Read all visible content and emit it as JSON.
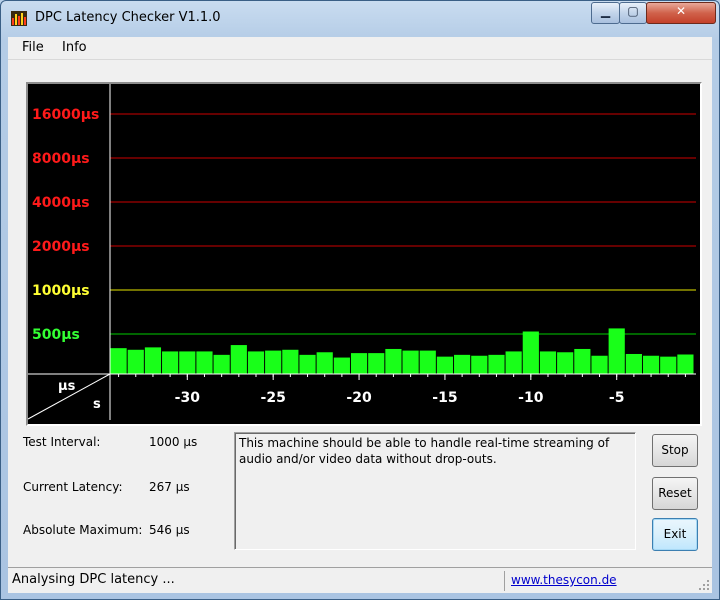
{
  "window": {
    "title": "DPC Latency Checker V1.1.0",
    "title_buttons": {
      "minimize": "▁",
      "maximize": "▢",
      "close": "✕"
    }
  },
  "menu": {
    "items": [
      "File",
      "Info"
    ]
  },
  "chart_data": {
    "type": "bar",
    "y_scale": "log2",
    "y_tick_labels": [
      "16000µs",
      "8000µs",
      "4000µs",
      "2000µs",
      "1000µs",
      "500µs"
    ],
    "y_ticks": [
      16000,
      8000,
      4000,
      2000,
      1000,
      500
    ],
    "y_tick_colors": [
      "#ff1a1a",
      "#ff1a1a",
      "#ff1a1a",
      "#ff1a1a",
      "#ffff33",
      "#33ff33"
    ],
    "gridline_colors": [
      "#cc0000",
      "#cc0000",
      "#cc0000",
      "#cc0000",
      "#e6e600",
      "#00cc00"
    ],
    "x_tick_labels": [
      "-30",
      "-25",
      "-20",
      "-15",
      "-10",
      "-5"
    ],
    "x_ticks": [
      -30,
      -25,
      -20,
      -15,
      -10,
      -5
    ],
    "x_range": [
      -34.5,
      -0.5
    ],
    "y_range": [
      250,
      20000
    ],
    "corner_labels": {
      "y_unit": "µs",
      "x_unit": "s"
    },
    "bar_color": "#19ff19",
    "x": [
      -34,
      -33,
      -32,
      -31,
      -30,
      -29,
      -28,
      -27,
      -26,
      -25,
      -24,
      -23,
      -22,
      -21,
      -20,
      -19,
      -18,
      -17,
      -16,
      -15,
      -14,
      -13,
      -12,
      -11,
      -10,
      -9,
      -8,
      -7,
      -6,
      -5,
      -4,
      -3,
      -2,
      -1
    ],
    "values": [
      400,
      390,
      405,
      380,
      380,
      380,
      360,
      420,
      380,
      385,
      390,
      360,
      375,
      345,
      370,
      370,
      395,
      385,
      385,
      350,
      360,
      355,
      360,
      380,
      520,
      380,
      375,
      395,
      355,
      546,
      365,
      355,
      350,
      362
    ]
  },
  "info": {
    "test_interval_label": "Test Interval:",
    "test_interval_value": "1000 µs",
    "current_latency_label": "Current Latency:",
    "current_latency_value": "267 µs",
    "absolute_maximum_label": "Absolute Maximum:",
    "absolute_maximum_value": "546 µs"
  },
  "message": "This machine should be able to handle real-time streaming of audio and/or video data without drop-outs.",
  "buttons": {
    "stop": "Stop",
    "reset": "Reset",
    "exit": "Exit"
  },
  "status": {
    "text": "Analysing DPC latency ...",
    "link": "www.thesycon.de"
  }
}
